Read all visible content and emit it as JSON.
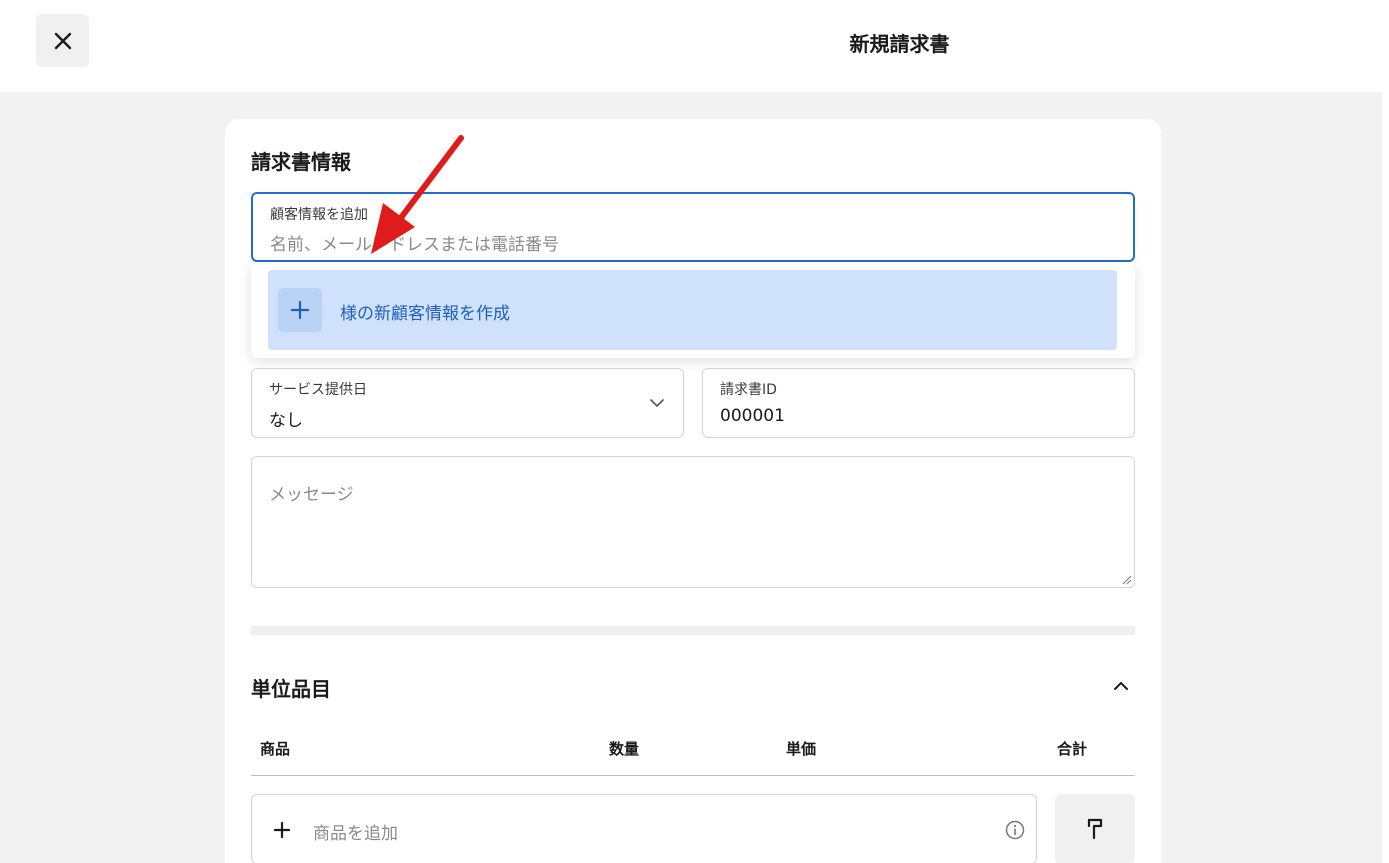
{
  "header": {
    "title": "新規請求書",
    "close_icon": "close-icon"
  },
  "invoice_info": {
    "section_title": "請求書情報",
    "customer_field": {
      "label": "顧客情報を追加",
      "placeholder": "名前、メールアドレスまたは電話番号"
    },
    "dropdown": {
      "create_label": "様の新顧客情報を作成",
      "icon": "plus-icon"
    },
    "service_date": {
      "label": "サービス提供日",
      "value": "なし",
      "icon": "chevron-down-icon"
    },
    "invoice_id": {
      "label": "請求書ID",
      "value": "000001"
    },
    "message": {
      "placeholder": "メッセージ"
    }
  },
  "line_items": {
    "section_title": "単位品目",
    "collapse_icon": "chevron-up-icon",
    "columns": [
      "商品",
      "数量",
      "単価",
      "合計"
    ],
    "add_item_placeholder": "商品を追加",
    "info_icon": "info-icon",
    "paint_icon": "paint-roller-icon"
  },
  "annotation": {
    "arrow_color": "#e01b1b"
  },
  "colors": {
    "accent": "#1f6fd1",
    "highlight": "#cfe1fb"
  }
}
